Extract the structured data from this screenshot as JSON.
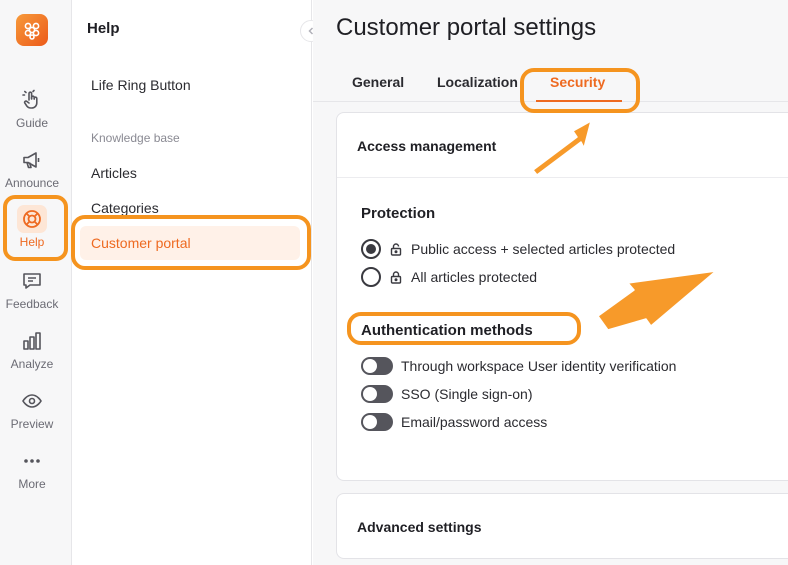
{
  "rail": {
    "items": [
      {
        "label": "Guide",
        "icon": "hand-pointer-icon"
      },
      {
        "label": "Announce",
        "icon": "megaphone-icon"
      },
      {
        "label": "Help",
        "icon": "life-ring-icon"
      },
      {
        "label": "Feedback",
        "icon": "feedback-chat-icon"
      },
      {
        "label": "Analyze",
        "icon": "bar-chart-icon"
      },
      {
        "label": "Preview",
        "icon": "eye-icon"
      },
      {
        "label": "More",
        "icon": "more-dots-icon"
      }
    ]
  },
  "nav": {
    "title": "Help",
    "life_ring": "Life Ring Button",
    "section": "Knowledge base",
    "articles": "Articles",
    "categories": "Categories",
    "customer_portal": "Customer portal"
  },
  "main": {
    "heading": "Customer portal settings",
    "tabs": [
      "General",
      "Localization",
      "Security"
    ],
    "active_tab": "Security",
    "access_management": "Access management",
    "protection": {
      "title": "Protection",
      "options": [
        "Public access + selected articles protected",
        "All articles protected"
      ],
      "selected": "Public access + selected articles protected"
    },
    "auth": {
      "title": "Authentication methods",
      "options": [
        "Through workspace User identity verification",
        "SSO (Single sign-on)",
        "Email/password access"
      ],
      "enabled": [
        false,
        false,
        false
      ]
    },
    "advanced_settings": "Advanced settings"
  },
  "colors": {
    "accent": "#ee6a21",
    "highlight": "#f5941f",
    "active_bg": "#fff1e8"
  }
}
